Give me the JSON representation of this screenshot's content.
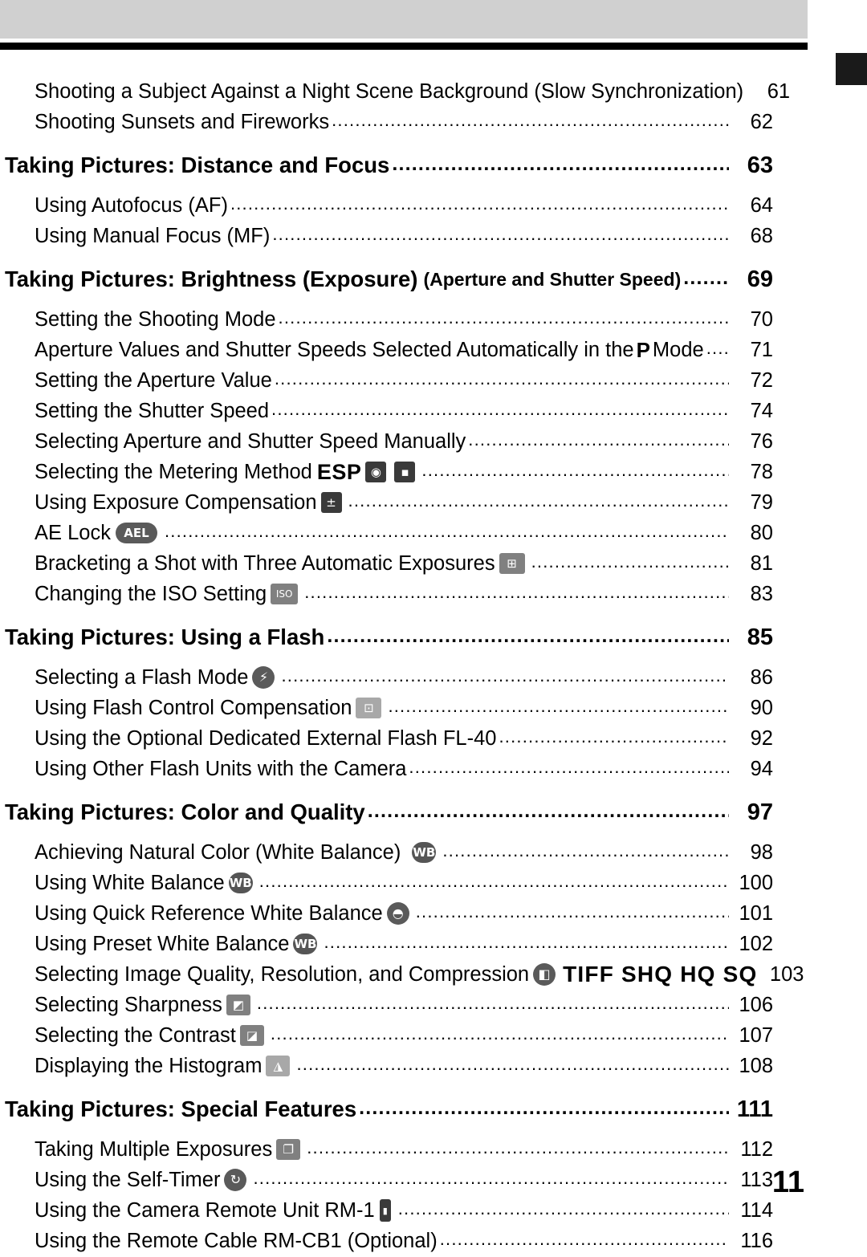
{
  "page": {
    "number": "11"
  },
  "toc": {
    "entries": [
      {
        "type": "sub",
        "text": "Shooting a Subject Against a Night Scene Background (Slow Synchronization)",
        "page": "61"
      },
      {
        "type": "sub",
        "text": "Shooting Sunsets and Fireworks",
        "page": "62"
      },
      {
        "type": "head",
        "text": "Taking Pictures: Distance and Focus",
        "page": "63"
      },
      {
        "type": "sub",
        "text": "Using Autofocus (AF)",
        "page": "64"
      },
      {
        "type": "sub",
        "text": "Using Manual Focus (MF)",
        "page": "68"
      },
      {
        "type": "head",
        "text": "Taking Pictures: Brightness (Exposure)",
        "note": "(Aperture and Shutter Speed)",
        "page": "69"
      },
      {
        "type": "sub",
        "text": "Setting the Shooting Mode",
        "page": "70"
      },
      {
        "type": "sub",
        "text": "Aperture Values and Shutter Speeds Selected Automatically in the",
        "mode": "P",
        "text2": "Mode",
        "page": "71"
      },
      {
        "type": "sub",
        "text": "Setting the Aperture Value",
        "page": "72"
      },
      {
        "type": "sub",
        "text": "Setting the Shutter Speed",
        "page": "74"
      },
      {
        "type": "sub",
        "text": "Selecting Aperture and Shutter Speed Manually",
        "page": "76"
      },
      {
        "type": "sub",
        "text": "Selecting the Metering Method",
        "icons": [
          "esp-text",
          "center-weighted-icon",
          "spot-metering-icon"
        ],
        "page": "78"
      },
      {
        "type": "sub",
        "text": "Using Exposure Compensation",
        "icons": [
          "exposure-compensation-icon"
        ],
        "page": "79"
      },
      {
        "type": "sub",
        "text": "AE Lock",
        "icons": [
          "ael-icon"
        ],
        "page": "80"
      },
      {
        "type": "sub",
        "text": "Bracketing a Shot with Three Automatic Exposures",
        "icons": [
          "bracketing-icon"
        ],
        "page": "81"
      },
      {
        "type": "sub",
        "text": "Changing the ISO Setting",
        "icons": [
          "iso-icon"
        ],
        "page": "83"
      },
      {
        "type": "head",
        "text": "Taking Pictures: Using a Flash",
        "page": "85"
      },
      {
        "type": "sub",
        "text": "Selecting a Flash Mode",
        "icons": [
          "flash-icon"
        ],
        "page": "86"
      },
      {
        "type": "sub",
        "text": "Using Flash Control Compensation",
        "icons": [
          "flash-compensation-icon"
        ],
        "page": "90"
      },
      {
        "type": "sub",
        "text": "Using the Optional Dedicated External Flash FL-40",
        "page": "92"
      },
      {
        "type": "sub",
        "text": "Using Other Flash Units with the Camera",
        "page": "94"
      },
      {
        "type": "head",
        "text": "Taking Pictures: Color and Quality",
        "page": "97"
      },
      {
        "type": "sub",
        "text": "Achieving Natural Color (White Balance)",
        "icons": [
          "wb-icon"
        ],
        "page": "98"
      },
      {
        "type": "sub",
        "text": "Using White Balance",
        "icons": [
          "wb-icon"
        ],
        "page": "100"
      },
      {
        "type": "sub",
        "text": "Using Quick Reference White Balance",
        "icons": [
          "quick-wb-icon"
        ],
        "page": "101"
      },
      {
        "type": "sub",
        "text": "Using Preset White Balance",
        "icons": [
          "wb-icon"
        ],
        "page": "102"
      },
      {
        "type": "sub",
        "text": "Selecting Image Quality, Resolution, and Compression",
        "icons": [
          "quality-icon"
        ],
        "quality": "TIFF SHQ HQ SQ",
        "page": "103"
      },
      {
        "type": "sub",
        "text": "Selecting Sharpness",
        "icons": [
          "sharpness-icon"
        ],
        "page": "106"
      },
      {
        "type": "sub",
        "text": "Selecting the Contrast",
        "icons": [
          "contrast-icon"
        ],
        "page": "107"
      },
      {
        "type": "sub",
        "text": "Displaying the Histogram",
        "icons": [
          "histogram-icon"
        ],
        "page": "108"
      },
      {
        "type": "head",
        "text": "Taking Pictures: Special Features",
        "page": "111"
      },
      {
        "type": "sub",
        "text": "Taking Multiple Exposures",
        "icons": [
          "multiple-exposure-icon"
        ],
        "page": "112"
      },
      {
        "type": "sub",
        "text": "Using the Self-Timer",
        "icons": [
          "self-timer-icon"
        ],
        "page": "113"
      },
      {
        "type": "sub",
        "text": "Using the Camera Remote Unit RM-1",
        "icons": [
          "remote-icon"
        ],
        "page": "114"
      },
      {
        "type": "sub",
        "text": "Using the Remote Cable RM-CB1 (Optional)",
        "page": "116"
      }
    ]
  }
}
